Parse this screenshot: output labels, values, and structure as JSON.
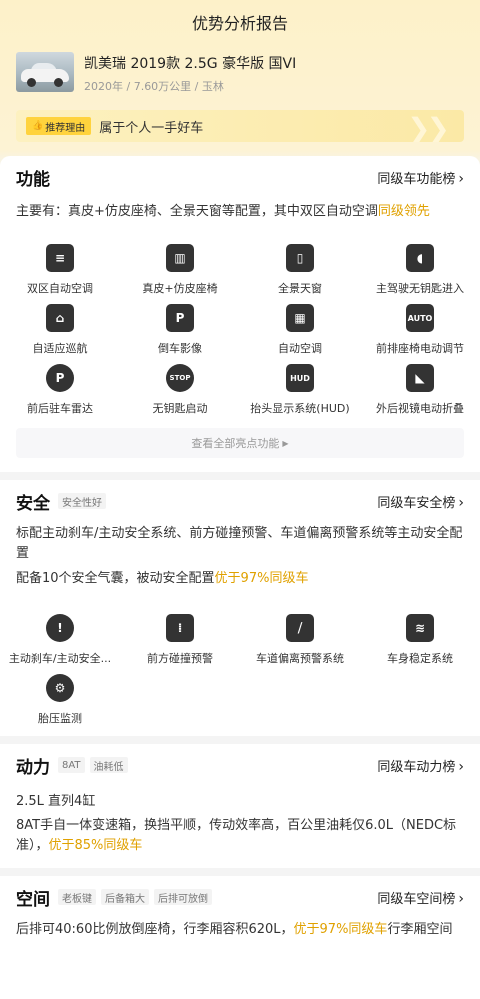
{
  "header": {
    "title": "优势分析报告"
  },
  "car": {
    "name": "凯美瑞 2019款 2.5G 豪华版 国VI",
    "meta": "2020年 / 7.60万公里 / 玉林"
  },
  "reason": {
    "badge": "推荐理由",
    "text": "属于个人一手好车"
  },
  "functions": {
    "title": "功能",
    "rank_link": "同级车功能榜",
    "desc_prefix": "主要有：真皮+仿皮座椅、全景天窗等配置，其中双区自动空调",
    "desc_highlight": "同级领先",
    "features": [
      {
        "label": "双区自动空调",
        "icon": "dual-zone-ac-icon"
      },
      {
        "label": "真皮+仿皮座椅",
        "icon": "leather-seat-icon"
      },
      {
        "label": "全景天窗",
        "icon": "panoramic-sunroof-icon"
      },
      {
        "label": "主驾驶无钥匙进入",
        "icon": "keyless-entry-icon"
      },
      {
        "label": "自适应巡航",
        "icon": "adaptive-cruise-icon"
      },
      {
        "label": "倒车影像",
        "icon": "rear-camera-icon"
      },
      {
        "label": "自动空调",
        "icon": "auto-ac-icon"
      },
      {
        "label": "前排座椅电动调节",
        "icon": "power-seat-icon"
      },
      {
        "label": "前后驻车雷达",
        "icon": "parking-radar-icon"
      },
      {
        "label": "无钥匙启动",
        "icon": "keyless-start-icon"
      },
      {
        "label": "抬头显示系统(HUD)",
        "icon": "hud-icon"
      },
      {
        "label": "外后视镜电动折叠",
        "icon": "mirror-fold-icon"
      }
    ],
    "more": "查看全部亮点功能"
  },
  "safety": {
    "title": "安全",
    "tag": "安全性好",
    "rank_link": "同级车安全榜",
    "desc1": "标配主动刹车/主动安全系统、前方碰撞预警、车道偏离预警系统等主动安全配置",
    "desc2_prefix": "配备10个安全气囊，被动安全配置",
    "desc2_highlight": "优于97%同级车",
    "features": [
      {
        "label": "主动刹车/主动安全...",
        "icon": "active-brake-icon"
      },
      {
        "label": "前方碰撞预警",
        "icon": "collision-warning-icon"
      },
      {
        "label": "车道偏离预警系统",
        "icon": "lane-departure-icon"
      },
      {
        "label": "车身稳定系统",
        "icon": "stability-control-icon"
      },
      {
        "label": "胎压监测",
        "icon": "tire-pressure-icon"
      }
    ]
  },
  "power": {
    "title": "动力",
    "tags": [
      "8AT",
      "油耗低"
    ],
    "rank_link": "同级车动力榜",
    "engine": "2.5L 直列4缸",
    "desc_prefix": "8AT手自一体变速箱，换挡平顺，传动效率高，百公里油耗仅6.0L（NEDC标准），",
    "desc_highlight": "优于85%同级车"
  },
  "space": {
    "title": "空间",
    "tags": [
      "老板键",
      "后备箱大",
      "后排可放倒"
    ],
    "rank_link": "同级车空间榜",
    "desc_prefix": "后排可40:60比例放倒座椅，行李厢容积620L，",
    "desc_highlight": "优于97%同级车",
    "desc_suffix": "行李厢空间"
  },
  "colors": {
    "highlight": "#e0a100",
    "badge": "#ffd33d"
  }
}
